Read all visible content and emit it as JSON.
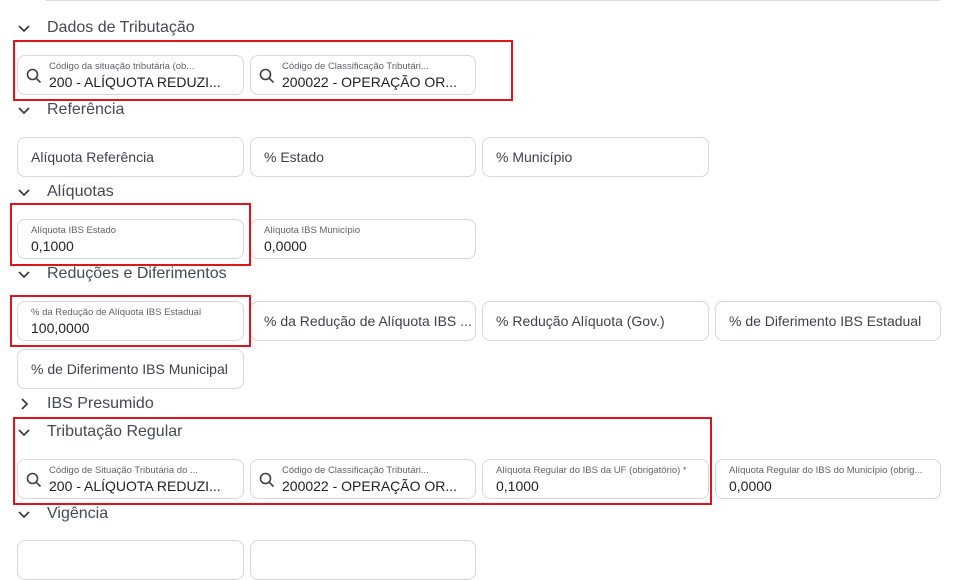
{
  "sections": {
    "dados": "Dados de Tributação",
    "referencia": "Referência",
    "aliquotas": "Alíquotas",
    "reducoes": "Reduções e Diferimentos",
    "ibs_presumido": "IBS Presumido",
    "tributacao_regular": "Tributação Regular",
    "vigencia": "Vigência"
  },
  "dados": {
    "cst": {
      "label": "Código da situação tributária (ob...",
      "value": "200 - ALÍQUOTA REDUZI..."
    },
    "cclass": {
      "label": "Código de Classificação Tributári...",
      "value": "200022 - OPERAÇÃO OR..."
    }
  },
  "referencia": {
    "aliquota": "Alíquota Referência",
    "estado": "% Estado",
    "municipio": "% Município"
  },
  "aliquotas": {
    "ibs_estado": {
      "label": "Alíquota IBS Estado",
      "value": "0,1000"
    },
    "ibs_municipio": {
      "label": "Alíquota IBS Município",
      "value": "0,0000"
    }
  },
  "reducoes": {
    "reducao_estadual": {
      "label": "% da Redução de Alíquota IBS Estadual",
      "value": "100,0000"
    },
    "reducao_municipal": "% da Redução de Alíquota IBS ...",
    "reducao_gov": "% Redução Alíquota (Gov.)",
    "diferimento_estadual": "% de Diferimento IBS Estadual",
    "diferimento_municipal": "% de Diferimento IBS Municipal"
  },
  "tributacao_regular": {
    "cst": {
      "label": "Código de Situação Tributária do ...",
      "value": "200 - ALÍQUOTA REDUZI..."
    },
    "cclass": {
      "label": "Código de Classificação Tributári...",
      "value": "200022 - OPERAÇÃO OR..."
    },
    "aliq_uf": {
      "label": "Alíquota Regular do IBS da UF (obrigatório) *",
      "value": "0,1000"
    },
    "aliq_mun": {
      "label": "Alíquota Regular do IBS do Município (obrig...",
      "value": "0,0000"
    }
  },
  "colors": {
    "highlight": "#e0141b",
    "border": "#d5d8dd"
  }
}
